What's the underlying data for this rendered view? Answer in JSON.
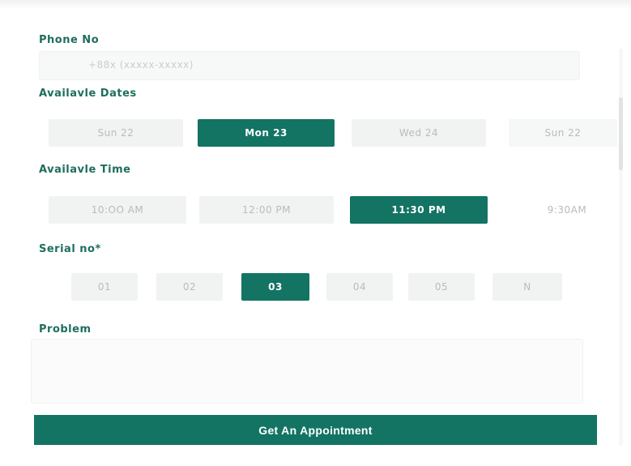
{
  "phone": {
    "label": "Phone No",
    "placeholder": "+88x (xxxxx-xxxxx)"
  },
  "dates": {
    "label": "Availavle Dates",
    "items": [
      {
        "text": "Sun 22",
        "selected": false
      },
      {
        "text": "Mon 23",
        "selected": true
      },
      {
        "text": "Wed 24",
        "selected": false
      },
      {
        "text": "Sun 22",
        "selected": false
      }
    ]
  },
  "times": {
    "label": "Availavle Time",
    "items": [
      {
        "text": "10:OO AM",
        "selected": false
      },
      {
        "text": "12:00 PM",
        "selected": false
      },
      {
        "text": "11:30 PM",
        "selected": true
      },
      {
        "text": "9:30AM",
        "selected": false
      }
    ]
  },
  "serial": {
    "label": "Serial no*",
    "items": [
      {
        "text": "01",
        "selected": false
      },
      {
        "text": "02",
        "selected": false
      },
      {
        "text": "03",
        "selected": true
      },
      {
        "text": "04",
        "selected": false
      },
      {
        "text": "05",
        "selected": false
      },
      {
        "text": "N",
        "selected": false
      }
    ]
  },
  "problem": {
    "label": "Problem",
    "value": ""
  },
  "submit_label": "Get An Appointment",
  "colors": {
    "accent": "#137463",
    "label": "#1e6e5d",
    "chip_bg": "#f1f3f3",
    "chip_text": "#b7bcbb"
  }
}
